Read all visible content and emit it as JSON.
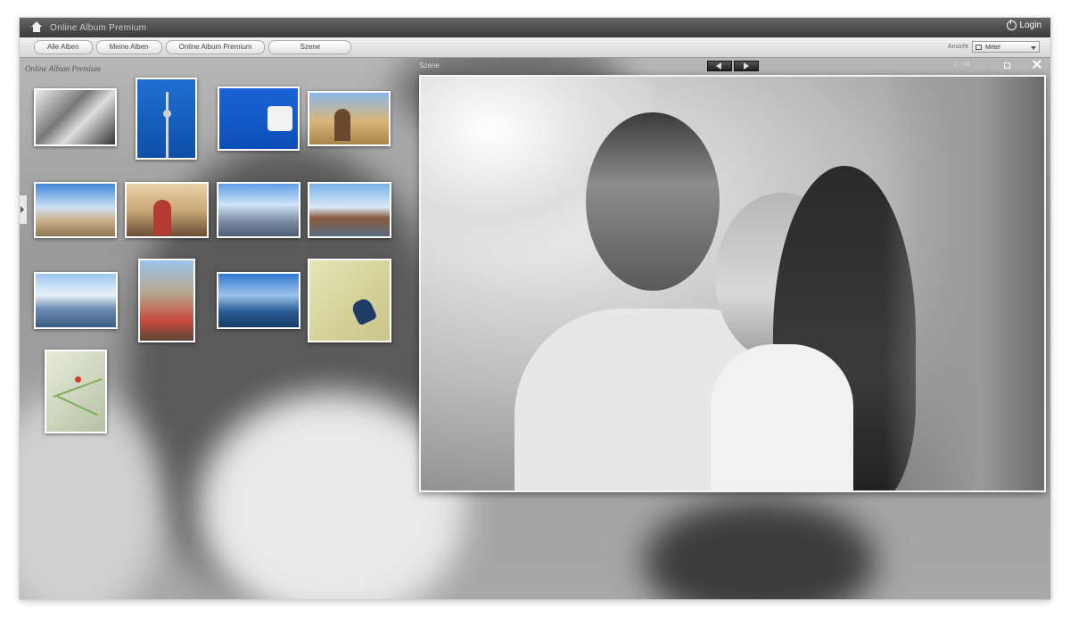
{
  "app": {
    "title": "Online Album Premium",
    "login_label": "Login"
  },
  "toolbar": {
    "breadcrumbs": [
      "Alle Alben",
      "Meine Alben",
      "Online Album Premium",
      "Szene"
    ],
    "view_label": "Ansicht",
    "view_select_value": "Mittel"
  },
  "album": {
    "title": "Online Album Premium"
  },
  "viewer": {
    "label": "Szene",
    "counter": "1 / 13"
  },
  "thumbnails": [
    "couple-bw",
    "tv-tower",
    "berlin-blue",
    "brandenburg-gate-woman",
    "brandenburg-gate",
    "couple-gate",
    "city-panorama",
    "oberbaum-bridge",
    "river-bridge",
    "cathedral-couple",
    "spree-skyline",
    "map-dog",
    "city-map"
  ],
  "colors": {
    "accent": "#1f5fbf",
    "titlebar": "#3a3a3a"
  }
}
